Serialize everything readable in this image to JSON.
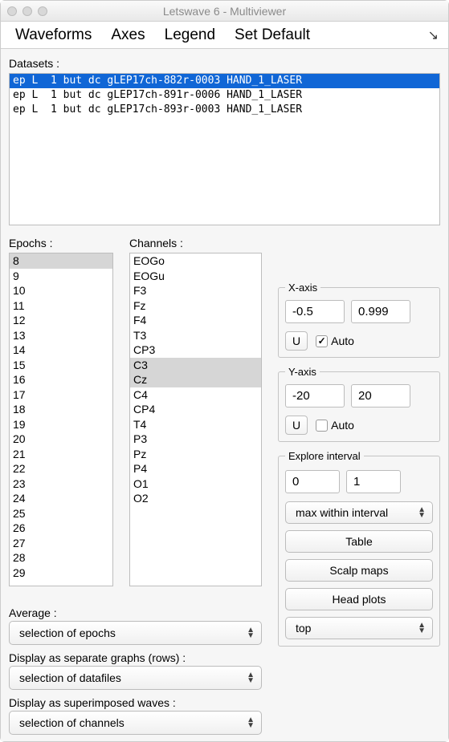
{
  "window": {
    "title": "Letswave 6 - Multiviewer"
  },
  "menu": {
    "waveforms": "Waveforms",
    "axes": "Axes",
    "legend": "Legend",
    "setdefault": "Set Default",
    "arrow": "↘"
  },
  "datasets": {
    "label": "Datasets :",
    "items": [
      {
        "text": "ep L  1 but dc gLEP17ch-882r-0003 HAND_1_LASER",
        "selected": true
      },
      {
        "text": "ep L  1 but dc gLEP17ch-891r-0006 HAND_1_LASER",
        "selected": false
      },
      {
        "text": "ep L  1 but dc gLEP17ch-893r-0003 HAND_1_LASER",
        "selected": false
      }
    ]
  },
  "epochs": {
    "label": "Epochs :",
    "items": [
      {
        "v": "8",
        "sel": true
      },
      {
        "v": "9",
        "sel": false
      },
      {
        "v": "10",
        "sel": false
      },
      {
        "v": "11",
        "sel": false
      },
      {
        "v": "12",
        "sel": false
      },
      {
        "v": "13",
        "sel": false
      },
      {
        "v": "14",
        "sel": false
      },
      {
        "v": "15",
        "sel": false
      },
      {
        "v": "16",
        "sel": false
      },
      {
        "v": "17",
        "sel": false
      },
      {
        "v": "18",
        "sel": false
      },
      {
        "v": "19",
        "sel": false
      },
      {
        "v": "20",
        "sel": false
      },
      {
        "v": "21",
        "sel": false
      },
      {
        "v": "22",
        "sel": false
      },
      {
        "v": "23",
        "sel": false
      },
      {
        "v": "24",
        "sel": false
      },
      {
        "v": "25",
        "sel": false
      },
      {
        "v": "26",
        "sel": false
      },
      {
        "v": "27",
        "sel": false
      },
      {
        "v": "28",
        "sel": false
      },
      {
        "v": "29",
        "sel": false
      }
    ]
  },
  "channels": {
    "label": "Channels :",
    "items": [
      {
        "v": "EOGo",
        "sel": false
      },
      {
        "v": "EOGu",
        "sel": false
      },
      {
        "v": "F3",
        "sel": false
      },
      {
        "v": "Fz",
        "sel": false
      },
      {
        "v": "F4",
        "sel": false
      },
      {
        "v": "T3",
        "sel": false
      },
      {
        "v": "CP3",
        "sel": false
      },
      {
        "v": "C3",
        "sel": true
      },
      {
        "v": "Cz",
        "sel": true
      },
      {
        "v": "C4",
        "sel": false
      },
      {
        "v": "CP4",
        "sel": false
      },
      {
        "v": "T4",
        "sel": false
      },
      {
        "v": "P3",
        "sel": false
      },
      {
        "v": "Pz",
        "sel": false
      },
      {
        "v": "P4",
        "sel": false
      },
      {
        "v": "O1",
        "sel": false
      },
      {
        "v": "O2",
        "sel": false
      }
    ]
  },
  "xaxis": {
    "legend": "X-axis",
    "min": "-0.5",
    "max": "0.999",
    "u": "U",
    "auto_label": "Auto",
    "auto_checked": true
  },
  "yaxis": {
    "legend": "Y-axis",
    "min": "-20",
    "max": "20",
    "u": "U",
    "auto_label": "Auto",
    "auto_checked": false
  },
  "explore": {
    "legend": "Explore interval",
    "a": "0",
    "b": "1",
    "mode": "max within interval",
    "table": "Table",
    "scalp": "Scalp maps",
    "head": "Head plots",
    "top": "top"
  },
  "bottom": {
    "average_label": "Average :",
    "average_value": "selection of epochs",
    "rows_label": "Display as separate graphs (rows) :",
    "rows_value": "selection of datafiles",
    "super_label": "Display as superimposed waves :",
    "super_value": "selection of channels"
  }
}
